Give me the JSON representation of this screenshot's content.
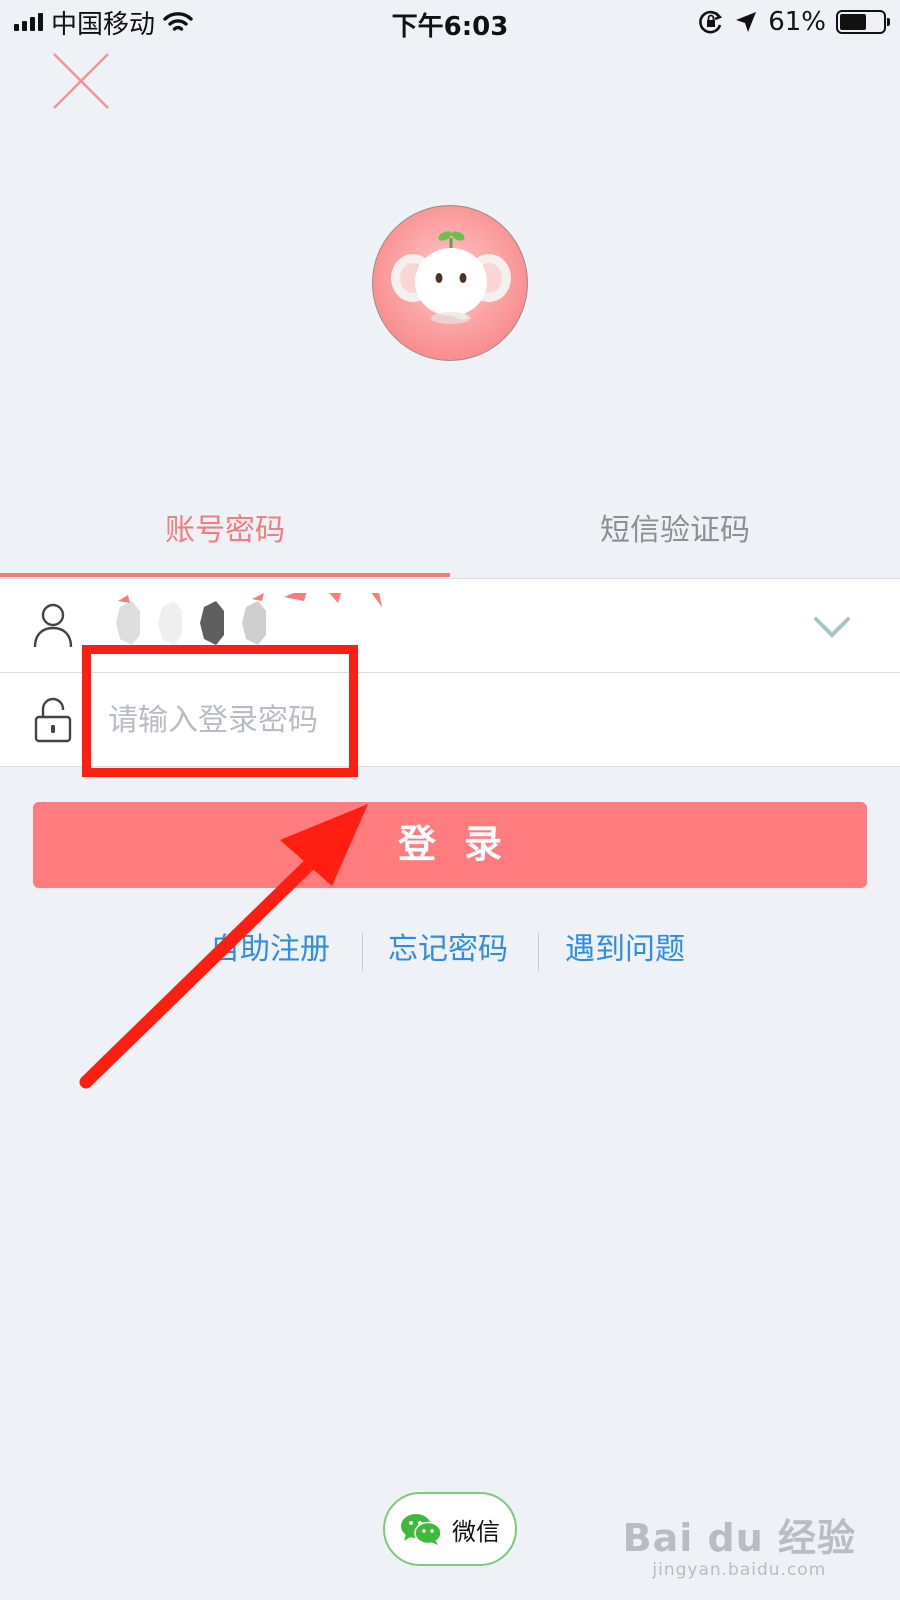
{
  "status_bar": {
    "carrier": "中国移动",
    "time": "下午6:03",
    "battery_text": "61%",
    "battery_level": 0.61
  },
  "login_tabs": {
    "account": "账号密码",
    "sms": "短信验证码",
    "active": "account"
  },
  "form": {
    "password_placeholder": "请输入登录密码"
  },
  "login_button": "登录",
  "links": {
    "register": "自助注册",
    "forgot": "忘记密码",
    "problem": "遇到问题"
  },
  "wechat": {
    "label": "微信"
  },
  "watermark": {
    "logo": "Bai du 经验",
    "url": "jingyan.baidu.com"
  },
  "colors": {
    "accent": "#fe7b7e",
    "tab_active": "#f27d80",
    "link": "#2f8ee3",
    "annotation": "#ff1e12",
    "wechat_green": "#7ccb7c"
  }
}
